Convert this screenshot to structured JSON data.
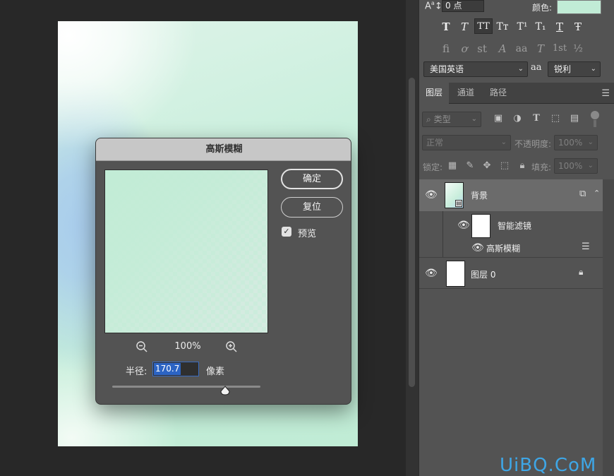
{
  "canvas": {
    "background_colors": [
      "#ffffff",
      "#a9cdec",
      "#c0ecd5"
    ]
  },
  "character_panel": {
    "tracking_value": "0 点",
    "color_label": "颜色:",
    "color_swatch": "#c1ecd6",
    "language": "美国英语",
    "antialias_icon": "aa",
    "antialias": "锐利",
    "style_buttons": [
      "T",
      "T",
      "TT",
      "Tт",
      "T¹",
      "T₁",
      "T",
      "Ŧ"
    ],
    "opentype_buttons": [
      "fi",
      "ơ",
      "st",
      "A",
      "aa",
      "T",
      "1st",
      "½"
    ]
  },
  "layers_panel": {
    "tabs": [
      "图层",
      "通道",
      "路径"
    ],
    "filter_kind": "类型",
    "blend_mode": "正常",
    "opacity_label": "不透明度:",
    "opacity_value": "100%",
    "lock_label": "锁定:",
    "fill_label": "填充:",
    "fill_value": "100%",
    "layers": [
      {
        "name": "背景",
        "type": "smart-object"
      },
      {
        "name": "智能滤镜",
        "type": "smart-filter-mask"
      },
      {
        "name": "高斯模糊",
        "type": "filter"
      },
      {
        "name": "图层 0",
        "type": "normal",
        "locked": true
      }
    ]
  },
  "dialog": {
    "title": "高斯模糊",
    "ok_label": "确定",
    "reset_label": "复位",
    "preview_label": "预览",
    "preview_checked": true,
    "zoom_level": "100%",
    "radius_label": "半径:",
    "radius_value": "170.7",
    "unit_label": "像素"
  },
  "watermark": "UiBQ.CoM"
}
